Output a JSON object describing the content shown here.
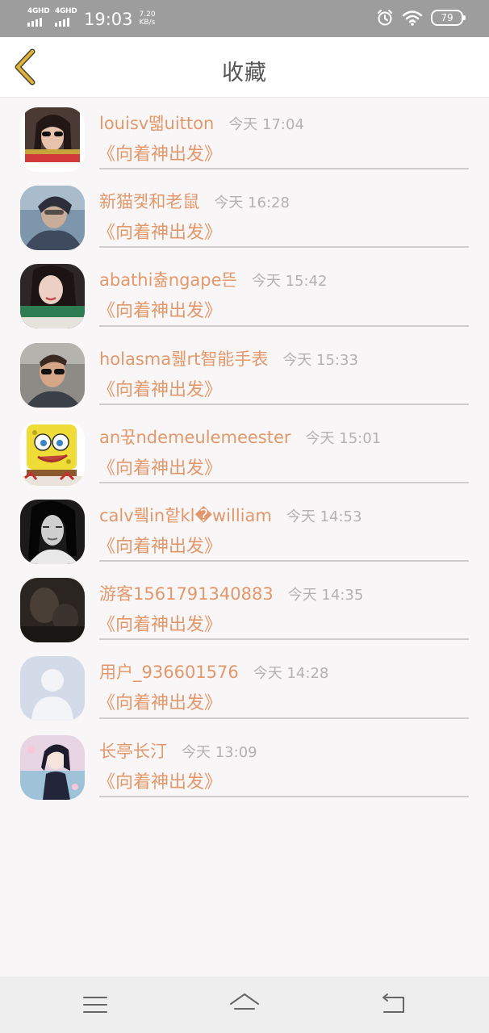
{
  "status_bar": {
    "network_1": "4GHD",
    "network_2": "4GHD",
    "time": "19:03",
    "speed_value": "7.20",
    "speed_unit": "KB/s",
    "battery": "79"
  },
  "header": {
    "title": "收藏",
    "back_icon": "chevron-left-icon",
    "accent": "#e0b23a"
  },
  "list": {
    "items": [
      {
        "username": "louisv뗿uitton",
        "time": "今天 17:04",
        "title": "《向着神出发》"
      },
      {
        "username": "新猫켗和老鼠",
        "time": "今天 16:28",
        "title": "《向着神出发》"
      },
      {
        "username": "abathi츎ngape뜬",
        "time": "今天 15:42",
        "title": "《向着神出发》"
      },
      {
        "username": "holasma뤮rt智能手表",
        "time": "今天 15:33",
        "title": "《向着神出发》"
      },
      {
        "username": "an꾻ndemeulemeester",
        "time": "今天 15:01",
        "title": "《向着神出发》"
      },
      {
        "username": "calv뤸in핱kl�william",
        "time": "今天 14:53",
        "title": "《向着神出发》"
      },
      {
        "username": "游客1561791340883",
        "time": "今天 14:35",
        "title": "《向着神出发》"
      },
      {
        "username": "用户_936601576",
        "time": "今天 14:28",
        "title": "《向着神出发》"
      },
      {
        "username": "长亭长汀",
        "time": "今天 13:09",
        "title": "《向着神出发》"
      }
    ]
  },
  "colors": {
    "text_accent": "#e3986b",
    "timestamp": "#b6b0b2",
    "divider": "#cfcccd"
  },
  "navbar": {
    "menu_icon": "menu-icon",
    "home_icon": "home-icon",
    "back_icon": "back-icon"
  }
}
